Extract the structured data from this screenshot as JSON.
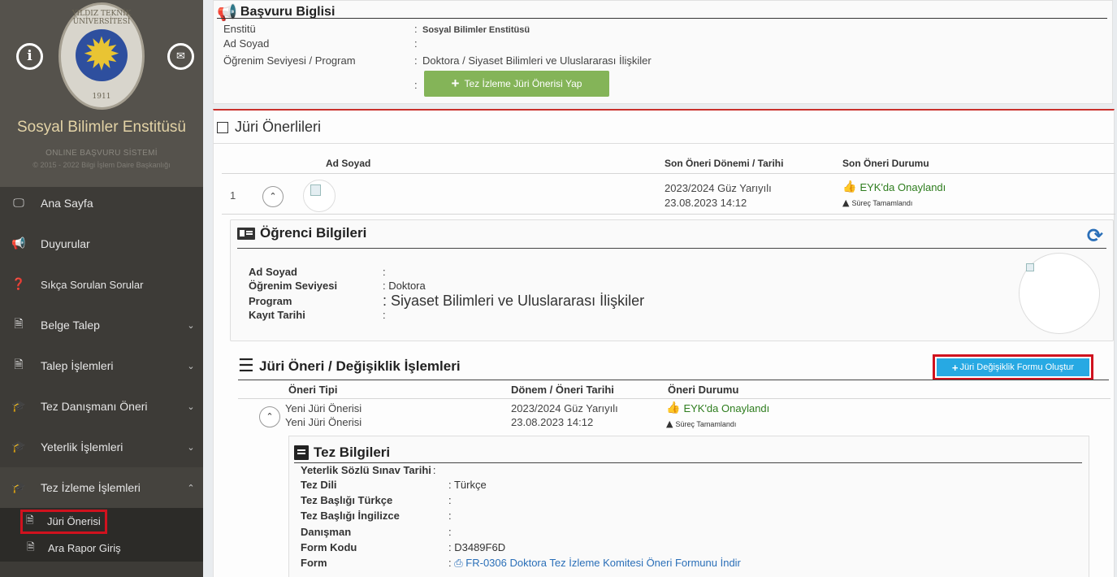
{
  "sidebar": {
    "info_icon": "i",
    "institute_name": "Sosyal Bilimler Enstitüsü",
    "system_name": "ONLINE BAŞVURU SİSTEMİ",
    "copyright": "© 2015 - 2022 Bilgi İşlem Daire Başkanlığı",
    "logo_year": "1911",
    "logo_text": "YILDIZ TEKNİK ÜNİVERSİTESİ",
    "menu": [
      {
        "label": "Ana Sayfa"
      },
      {
        "label": "Duyurular"
      },
      {
        "label": "Sıkça Sorulan Sorular"
      },
      {
        "label": "Belge Talep"
      },
      {
        "label": "Talep İşlemleri"
      },
      {
        "label": "Tez Danışmanı Öneri"
      },
      {
        "label": "Yeterlik İşlemleri"
      },
      {
        "label": "Tez İzleme İşlemleri"
      }
    ],
    "submenu": [
      {
        "label": "Jüri Önerisi"
      },
      {
        "label": "Ara Rapor Giriş"
      }
    ]
  },
  "application": {
    "title": "Başvuru Biglisi",
    "rows": [
      {
        "label": "Enstitü",
        "sep": ":",
        "value": "Sosyal Bilimler Enstitüsü"
      },
      {
        "label": "Ad Soyad",
        "sep": ":",
        "value": ""
      },
      {
        "label": "Öğrenim Seviyesi / Program",
        "sep": ":",
        "value": "Doktora / Siyaset Bilimleri ve Uluslararası İlişkiler"
      }
    ],
    "button_sep": ":",
    "button_label": "Tez İzleme Jüri Önerisi Yap"
  },
  "juri": {
    "title": "Jüri Önerlileri",
    "columns": {
      "name": "Ad Soyad",
      "period": "Son Öneri Dönemi / Tarihi",
      "status": "Son Öneri Durumu"
    },
    "row": {
      "index": "1",
      "period": "2023/2024 Güz Yarıyılı",
      "date": "23.08.2023 14:12",
      "status": "EYK'da Onaylandı",
      "substatus": "Süreç Tamamlandı"
    }
  },
  "student": {
    "title": "Öğrenci Bilgileri",
    "rows": [
      {
        "label": "Ad Soyad",
        "value": ":"
      },
      {
        "label": "Öğrenim Seviyesi",
        "value": ": Doktora"
      },
      {
        "label": "Program",
        "value": ": Siyaset Bilimleri ve Uluslararası İlişkiler"
      },
      {
        "label": "Kayıt Tarihi",
        "value": ":"
      }
    ]
  },
  "changes": {
    "title": "Jüri Öneri / Değişiklik İşlemleri",
    "button_label": "Jüri Değişiklik Formu Oluştur",
    "columns": {
      "type": "Öneri Tipi",
      "period": "Dönem / Öneri Tarihi",
      "status": "Öneri Durumu"
    },
    "row": {
      "type1": "Yeni Jüri Önerisi",
      "type2": "Yeni Jüri Önerisi",
      "period": "2023/2024 Güz Yarıyılı",
      "date": "23.08.2023 14:12",
      "status": "EYK'da Onaylandı",
      "substatus": "Süreç Tamamlandı"
    }
  },
  "thesis": {
    "title": "Tez Bilgileri",
    "rows": [
      {
        "label": "Yeterlik Sözlü Sınav Tarihi",
        "value": ":"
      },
      {
        "label": "Tez Dili",
        "value": ": Türkçe"
      },
      {
        "label": "Tez Başlığı Türkçe",
        "value": ":"
      },
      {
        "label": "Tez Başlığı İngilizce",
        "value": ":"
      },
      {
        "label": "Danışman",
        "value": ":"
      },
      {
        "label": "Form Kodu",
        "value": ": D3489F6D"
      }
    ],
    "form_label": "Form",
    "form_sep": ":",
    "form_link": "FR-0306 Doktora Tez İzleme Komitesi Öneri Formunu İndir"
  }
}
